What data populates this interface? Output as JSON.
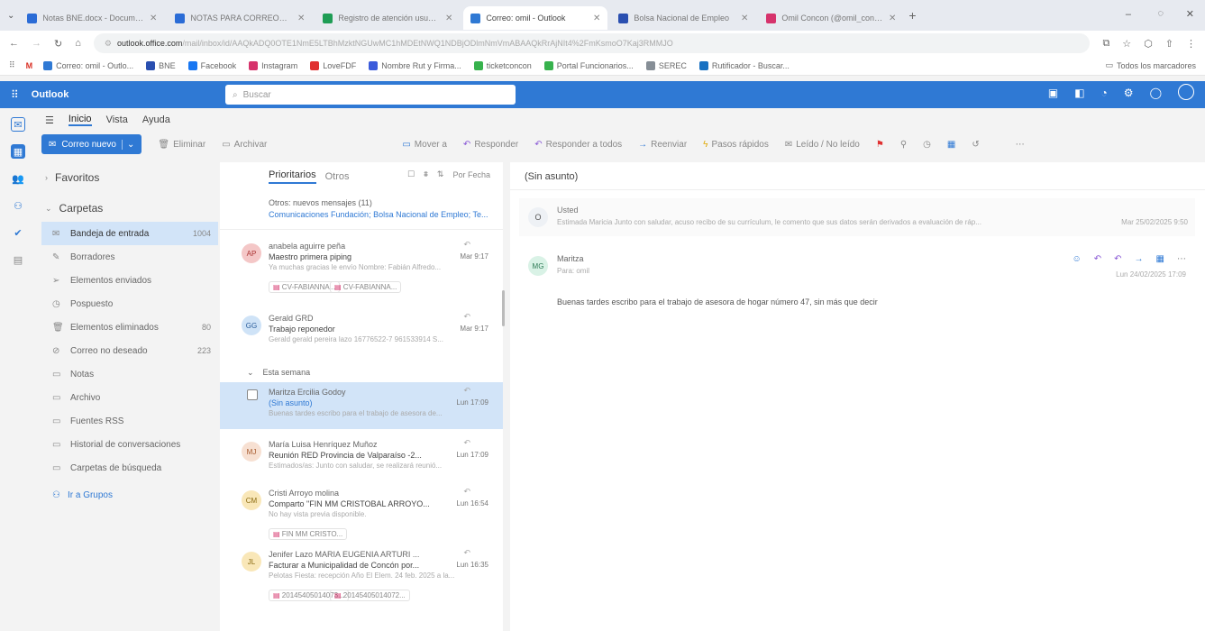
{
  "browser": {
    "tabs": [
      {
        "title": "Notas BNE.docx - Documento...",
        "color": "#2b6cd6",
        "active": false
      },
      {
        "title": "NOTAS PARA CORREOS.docx",
        "color": "#2b6cd6",
        "active": false
      },
      {
        "title": "Registro de atención usuarios",
        "color": "#1f9d55",
        "active": false
      },
      {
        "title": "Correo: omil - Outlook",
        "color": "#2f79d4",
        "active": true
      },
      {
        "title": "Bolsa Nacional de Empleo",
        "color": "#2a4fb0",
        "active": false
      },
      {
        "title": "Omil Concon (@omil_concon)",
        "color": "#d6336c",
        "active": false
      }
    ],
    "url_host": "outlook.office.com",
    "url_rest": "/mail/inbox/id/AAQkADQ0OTE1NmE5LTBhMzktNGUwMC1hMDEtNWQ1NDBjODlmNmVmABAAQkRrAjNIt4%2FmKsmoO7Kaj3RMMJO",
    "bookmarks": [
      {
        "label": "Correo: omil - Outlo...",
        "color": "#2f79d4"
      },
      {
        "label": "BNE",
        "color": "#2a4fb0"
      },
      {
        "label": "Facebook",
        "color": "#1877f2"
      },
      {
        "label": "Instagram",
        "color": "#d6336c"
      },
      {
        "label": "LoveFDF",
        "color": "#e03131"
      },
      {
        "label": "Nombre Rut y Firma...",
        "color": "#3b5bdb"
      },
      {
        "label": "ticketconcon",
        "color": "#37b24d"
      },
      {
        "label": "Portal Funcionarios...",
        "color": "#37b24d"
      },
      {
        "label": "SEREC",
        "color": "#868e96"
      },
      {
        "label": "Rutificador - Buscar...",
        "color": "#1971c2"
      }
    ],
    "all_bookmarks": "Todos los marcadores"
  },
  "app": {
    "name": "Outlook",
    "search_placeholder": "Buscar",
    "accent": "#2f79d4"
  },
  "menu_tabs": [
    "Inicio",
    "Vista",
    "Ayuda"
  ],
  "ribbon": {
    "new_mail": "Correo nuevo",
    "delete": "Eliminar",
    "archive": "Archivar",
    "move": "Mover a",
    "reply": "Responder",
    "reply_all": "Responder a todos",
    "forward": "Reenviar",
    "quick_steps": "Pasos rápidos",
    "read_unread": "Leído / No leído"
  },
  "folders": {
    "favorites": "Favoritos",
    "folders_title": "Carpetas",
    "items": [
      {
        "label": "Bandeja de entrada",
        "count": "1004",
        "selected": true
      },
      {
        "label": "Borradores",
        "count": ""
      },
      {
        "label": "Elementos enviados",
        "count": ""
      },
      {
        "label": "Pospuesto",
        "count": ""
      },
      {
        "label": "Elementos eliminados",
        "count": "80"
      },
      {
        "label": "Correo no deseado",
        "count": "223"
      },
      {
        "label": "Notas",
        "count": ""
      },
      {
        "label": "Archivo",
        "count": ""
      },
      {
        "label": "Fuentes RSS",
        "count": ""
      },
      {
        "label": "Historial de conversaciones",
        "count": ""
      },
      {
        "label": "Carpetas de búsqueda",
        "count": ""
      }
    ],
    "go_groups": "Ir a Grupos"
  },
  "list": {
    "tab_focused": "Prioritarios",
    "tab_other": "Otros",
    "sort": "Por Fecha",
    "other_new": "Otros: nuevos mensajes (11)",
    "other_senders": "Comunicaciones Fundación; Bolsa Nacional de Empleo; Te...",
    "section_week": "Esta semana",
    "messages": [
      {
        "initials": "AP",
        "avcolor": "#f4c7c7",
        "avtext": "#a33",
        "sender": "anabela aguirre peña",
        "subject": "Maestro primera piping",
        "time": "Mar 9:17",
        "preview": "Ya muchas gracias le envío Nombre: Fabián Alfredo...",
        "attachments": [
          "CV-FABIANNA...",
          "CV-FABIANNA..."
        ]
      },
      {
        "initials": "GG",
        "avcolor": "#cfe3f7",
        "avtext": "#2a5d9b",
        "sender": "Gerald GRD",
        "subject": "Trabajo reponedor",
        "time": "Mar 9:17",
        "preview": "Gerald gerald pereira lazo 16776522-7 961533914 S...",
        "attachments": []
      },
      {
        "initials": "",
        "avcolor": "#ffffff",
        "avtext": "#666",
        "sender": "Maritza Ercilia Godoy",
        "subject": "(Sin asunto)",
        "time": "Lun 17:09",
        "preview": "Buenas tardes escribo para el trabajo de asesora de...",
        "attachments": [],
        "selected": true
      },
      {
        "initials": "MJ",
        "avcolor": "#f7e0d2",
        "avtext": "#a65a2e",
        "sender": "María Luisa Henríquez Muñoz",
        "subject": "Reunión RED Provincia de Valparaíso -2...",
        "time": "Lun 17:09",
        "preview": "Estimados/as: Junto con saludar, se realizará reunió...",
        "attachments": []
      },
      {
        "initials": "CM",
        "avcolor": "#f9e7b8",
        "avtext": "#8a6a10",
        "sender": "Cristi Arroyo molina",
        "subject": "Comparto \"FIN MM CRISTOBAL ARROYO...",
        "time": "Lun 16:54",
        "preview": "No hay vista previa disponible.",
        "attachments": [
          "FIN MM CRISTO..."
        ]
      },
      {
        "initials": "JL",
        "avcolor": "#f9e7b8",
        "avtext": "#8a6a10",
        "sender": "Jenifer Lazo MARIA EUGENIA ARTURI ...",
        "subject": "Facturar a Municipalidad de Concón por...",
        "time": "Lun 16:35",
        "preview": "Pelotas Fiesta: recepción Año El Elem. 24 feb. 2025 a la...",
        "attachments": [
          "20145405014073...",
          "20145405014072..."
        ]
      }
    ]
  },
  "reading": {
    "subject": "(Sin asunto)",
    "first": {
      "initial": "O",
      "from": "Usted",
      "preview": "Estimada Maricia Junto con saludar, acuso recibo de su currículum, le comento que sus datos serán derivados a evaluación de ráp...",
      "date": "Mar 25/02/2025 9:50"
    },
    "second": {
      "initials": "MG",
      "from": "Maritza",
      "to": "Para: omil",
      "date": "Lun 24/02/2025 17:09",
      "body": "Buenas tardes escribo para el trabajo de asesora de hogar número 47, sin más que decir"
    }
  }
}
